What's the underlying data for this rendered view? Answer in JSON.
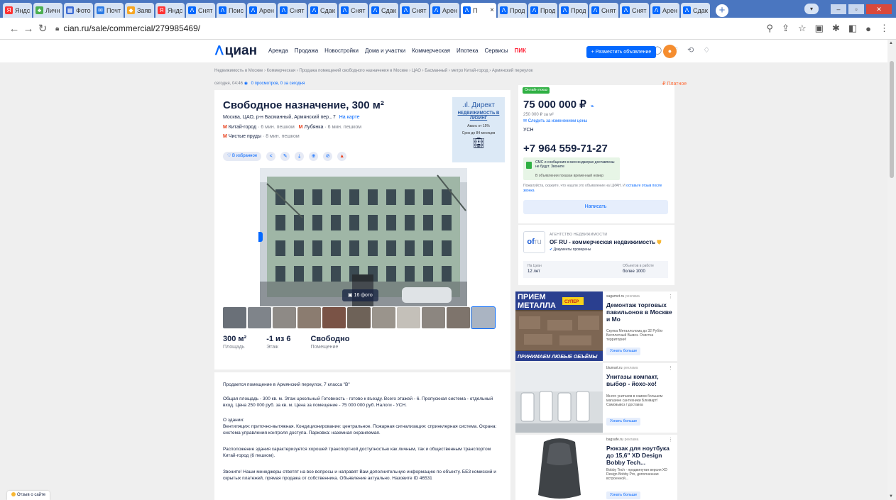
{
  "browser": {
    "tabs": [
      {
        "label": "Яндс",
        "color": "#f33",
        "ch": "Я"
      },
      {
        "label": "Личн",
        "color": "#4caf50",
        "ch": "♣"
      },
      {
        "label": "Фото",
        "color": "#3a6ad4",
        "ch": "▦"
      },
      {
        "label": "Почт",
        "color": "#2c7be5",
        "ch": "✉"
      },
      {
        "label": "Заяв",
        "color": "#f6a623",
        "ch": "◆"
      },
      {
        "label": "Яндс",
        "color": "#f33",
        "ch": "Я"
      },
      {
        "label": "Сняты",
        "color": "#0468ff",
        "ch": "ᐱ"
      },
      {
        "label": "Поис",
        "color": "#0468ff",
        "ch": "ᐱ"
      },
      {
        "label": "Арен",
        "color": "#0468ff",
        "ch": "ᐱ"
      },
      {
        "label": "Сняты",
        "color": "#0468ff",
        "ch": "ᐱ"
      },
      {
        "label": "Сдаю",
        "color": "#0468ff",
        "ch": "ᐱ"
      },
      {
        "label": "Сняты",
        "color": "#0468ff",
        "ch": "ᐱ"
      },
      {
        "label": "Сдаю",
        "color": "#0468ff",
        "ch": "ᐱ"
      },
      {
        "label": "Сняты",
        "color": "#0468ff",
        "ch": "ᐱ"
      },
      {
        "label": "Арен",
        "color": "#0468ff",
        "ch": "ᐱ"
      },
      {
        "label": "П",
        "color": "#0468ff",
        "ch": "ᐱ",
        "active": true
      },
      {
        "label": "Прод",
        "color": "#0468ff",
        "ch": "ᐱ"
      },
      {
        "label": "Прод",
        "color": "#0468ff",
        "ch": "ᐱ"
      },
      {
        "label": "Прод",
        "color": "#0468ff",
        "ch": "ᐱ"
      },
      {
        "label": "Сняты",
        "color": "#0468ff",
        "ch": "ᐱ"
      },
      {
        "label": "Сняты",
        "color": "#0468ff",
        "ch": "ᐱ"
      },
      {
        "label": "Арен",
        "color": "#0468ff",
        "ch": "ᐱ"
      },
      {
        "label": "Сдаю",
        "color": "#0468ff",
        "ch": "ᐱ"
      }
    ],
    "active_close": "×",
    "new_tab": "+",
    "url": "cian.ru/sale/commercial/279985469/"
  },
  "header": {
    "logo": "циан",
    "nav": [
      "Аренда",
      "Продажа",
      "Новостройки",
      "Дома и участки",
      "Коммерческая",
      "Ипотека",
      "Сервисы"
    ],
    "pik": "ПИК",
    "post_button": "+ Разместить объявление"
  },
  "breadcrumbs": "Недвижимость в Москве  ›  Коммерческая  ›  Продажа помещений свободного назначения в Москве  ›  ЦАО  ›  Басманный  ›  метро Китай-город  ›  Армянский переулок",
  "meta": {
    "date": "сегодня, 04:46",
    "views": "0 просмотров, 0 за сегодня",
    "paid": "₽ Платное"
  },
  "listing": {
    "title": "Свободное назначение, 300 м²",
    "address": "Москва, ЦАО, р-н Басманный, Армянский пер., 7",
    "map_link": "На карте",
    "metro": [
      {
        "stations": [
          {
            "name": "Китай-город",
            "walk": "6 мин. пешком"
          },
          {
            "name": "Лубянка",
            "walk": "6 мин. пешком"
          }
        ]
      },
      {
        "stations": [
          {
            "name": "Чистые пруды",
            "walk": "8 мин. пешком"
          }
        ]
      }
    ],
    "favorite": "В избранное",
    "photo_count": "16 фото",
    "facts": [
      {
        "value": "300 м²",
        "label": "Площадь"
      },
      {
        "value": "-1 из 6",
        "label": "Этаж"
      },
      {
        "value": "Свободно",
        "label": "Помещение"
      }
    ],
    "description": [
      "Продается помещение в Армянский переулок, 7 класса \"В\"",
      "Общая площадь - 300 кв. м. Этаж цокольный Готовность - готово к въезду. Всего этажей - 6. Пропускная система - отдельный вход. Цена 250 000 руб. за кв. м. Цена за помещение - 75 000 000 руб. Налоги - УСН.",
      "О здании:\nВентиляция: приточно-вытяжная. Кондиционирование: центральное. Пожарная сигнализация: спринклерная система. Охрана: система управления контроля доступа. Парковка: наземная охраняемая.",
      "Расположение здания характеризуется хорошей транспортной доступностью как личным, так и общественным транспортом Китай-город (6  пешком).",
      "Звоните! Наши менеджеры ответят на все вопросы и направят Вам дополнительную информацию по объекту. БЕЗ комиссий и скрытых платежей, прямая продажа от собственника. Объявление актуально. Назовите ID 46531"
    ]
  },
  "direct_ad": {
    "brand": ".ıl. Директ",
    "sub": "НЕДВИЖИМОСТЬ В ЛИЗИНГ",
    "line1": "Аванс от 15%",
    "line2": "Срок до 84 месяцев"
  },
  "price_card": {
    "badge": "Онлайн показ",
    "price": "75 000 000 ₽",
    "per_m2": "250 000 ₽ за м²",
    "follow": "Следить за изменением цены",
    "tax": "УСН",
    "phone": "+7 964 559-71-27",
    "sms": "СМС и сообщения в мессенджерах доставлены не будут. Звоните",
    "sms_note": "В объявлении показан временный номер",
    "note": "Пожалуйста, скажите, что нашли это объявление на ЦИАН. И ",
    "note_link": "оставьте отзыв после звонка",
    "write": "Написать"
  },
  "agency": {
    "logo": "of",
    "logo2": "ru",
    "tag": "АГЕНТСТВО НЕДВИЖИМОСТИ",
    "name": "OF RU - коммерческая недвижимость",
    "verified": "Документы проверены",
    "stat1_label": "На Циан",
    "stat1_value": "12 лет",
    "stat2_label": "Объектов в работе",
    "stat2_value": "более 1000"
  },
  "ads": [
    {
      "source": "sagamet.ru",
      "tag": "реклама",
      "title": "Демонтаж торговых павильонов в Москве и Мо",
      "body": "Скупка Металлолома до 32 Руб/кг Бесплатный Вывоз. Очистка территории!",
      "button": "Узнать больше",
      "img_text1": "ПРИЕМ",
      "img_text2": "МЕТАЛЛА",
      "img_text3": "ПРИНИМАЕМ ЛЮБЫЕ ОБЪЁМЫ",
      "img_badge": "СУПЕР"
    },
    {
      "source": "blumart.ru",
      "tag": "реклама",
      "title": "Унитазы компакт, выбор - йохо-хо!",
      "body": "Много унитазов в самом большом магазине сантехники Блюмарт! Самовывоз / доставка",
      "button": "Узнать больше"
    },
    {
      "source": "bagsafe.ru",
      "tag": "реклама",
      "title": "Рюкзак для ноутбука до 15,6\" XD Design Bobby Tech...",
      "body": "Bobby Tech - продвинутая версия XD Design Bobby Pro, дополненная встроенной...",
      "button": "Узнать больше"
    }
  ],
  "feedback": "Отзыв о сайте"
}
